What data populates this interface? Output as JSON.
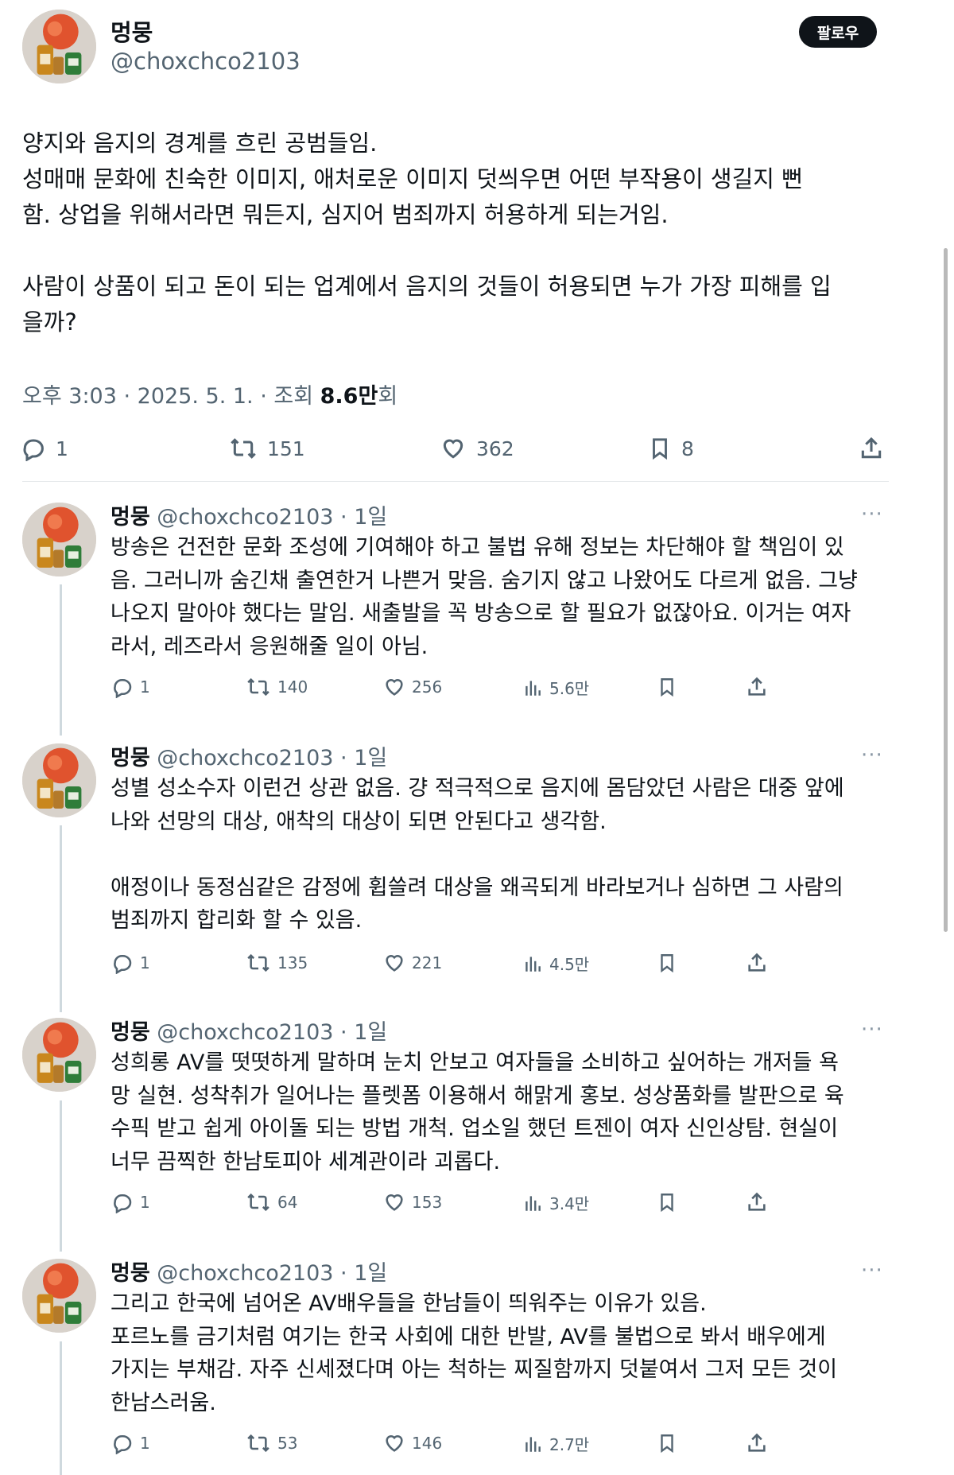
{
  "post": {
    "author_name": "멍뭉",
    "author_handle": "@choxchco2103",
    "follow_label": "팔로우",
    "paragraph1": [
      "양지와 음지의 경계를 흐린 공범들임.",
      "성매매 문화에 친숙한 이미지, 애처로운 이미지 덧씌우면 어떤 부작용이 생길지 뻔",
      "함. 상업을 위해서라면 뭐든지, 심지어 범죄까지 허용하게 되는거임."
    ],
    "paragraph2": [
      "사람이 상품이 되고 돈이 되는 업계에서 음지의 것들이 허용되면 누가 가장 피해를 입",
      "을까?"
    ],
    "meta_prefix": "오후 3:03 · 2025. 5. 1. · 조회 ",
    "meta_views": "8.6만",
    "meta_suffix": "회",
    "actions": {
      "replies": "1",
      "reposts": "151",
      "likes": "362",
      "bookmarks": "8"
    }
  },
  "replies": [
    {
      "name": "멍뭉",
      "handle_time": "@choxchco2103 · 1일",
      "more": "···",
      "lines1": [
        "방송은 건전한 문화 조성에 기여해야 하고 불법 유해 정보는 차단해야 할 책임이 있",
        "음. 그러니까 숨긴채 출연한거 나쁜거 맞음. 숨기지 않고 나왔어도 다르게 없음. 그냥",
        "나오지 말아야 했다는 말임. 새출발을 꼭 방송으로 할 필요가 없잖아요. 이거는 여자",
        "라서, 레즈라서 응원해줄 일이 아님."
      ],
      "lines2": [],
      "stats": {
        "replies": "1",
        "reposts": "140",
        "likes": "256",
        "views": "5.6만"
      }
    },
    {
      "name": "멍뭉",
      "handle_time": "@choxchco2103 · 1일",
      "more": "···",
      "lines1": [
        "성별 성소수자 이런건 상관 없음. 걍 적극적으로 음지에 몸담았던 사람은 대중 앞에",
        "나와 선망의 대상, 애착의 대상이 되면 안된다고 생각함."
      ],
      "lines2": [
        "애정이나 동정심같은 감정에 휩쓸려 대상을 왜곡되게 바라보거나 심하면 그 사람의",
        "범죄까지 합리화 할 수 있음."
      ],
      "stats": {
        "replies": "1",
        "reposts": "135",
        "likes": "221",
        "views": "4.5만"
      }
    },
    {
      "name": "멍뭉",
      "handle_time": "@choxchco2103 · 1일",
      "more": "···",
      "lines1": [
        "성희롱 AV를 떳떳하게 말하며 눈치 안보고 여자들을 소비하고 싶어하는 개저들 욕",
        "망 실현. 성착취가 일어나는 플렛폼 이용해서 해맑게 홍보. 성상품화를 발판으로 육",
        "수픽 받고 쉽게 아이돌 되는 방법 개척. 업소일 했던 트젠이 여자 신인상탐. 현실이",
        "너무 끔찍한 한남토피아 세계관이라 괴롭다."
      ],
      "lines2": [],
      "stats": {
        "replies": "1",
        "reposts": "64",
        "likes": "153",
        "views": "3.4만"
      }
    },
    {
      "name": "멍뭉",
      "handle_time": "@choxchco2103 · 1일",
      "more": "···",
      "lines1": [
        "그리고 한국에 넘어온 AV배우들을 한남들이 띄워주는 이유가 있음.",
        "포르노를 금기처럼 여기는 한국 사회에 대한 반발, AV를 불법으로 봐서 배우에게",
        "가지는 부채감. 자주 신세졌다며 아는 척하는 찌질함까지 덧붙여서 그저 모든 것이",
        "한남스러움."
      ],
      "lines2": [],
      "stats": {
        "replies": "1",
        "reposts": "53",
        "likes": "146",
        "views": "2.7만"
      }
    }
  ]
}
